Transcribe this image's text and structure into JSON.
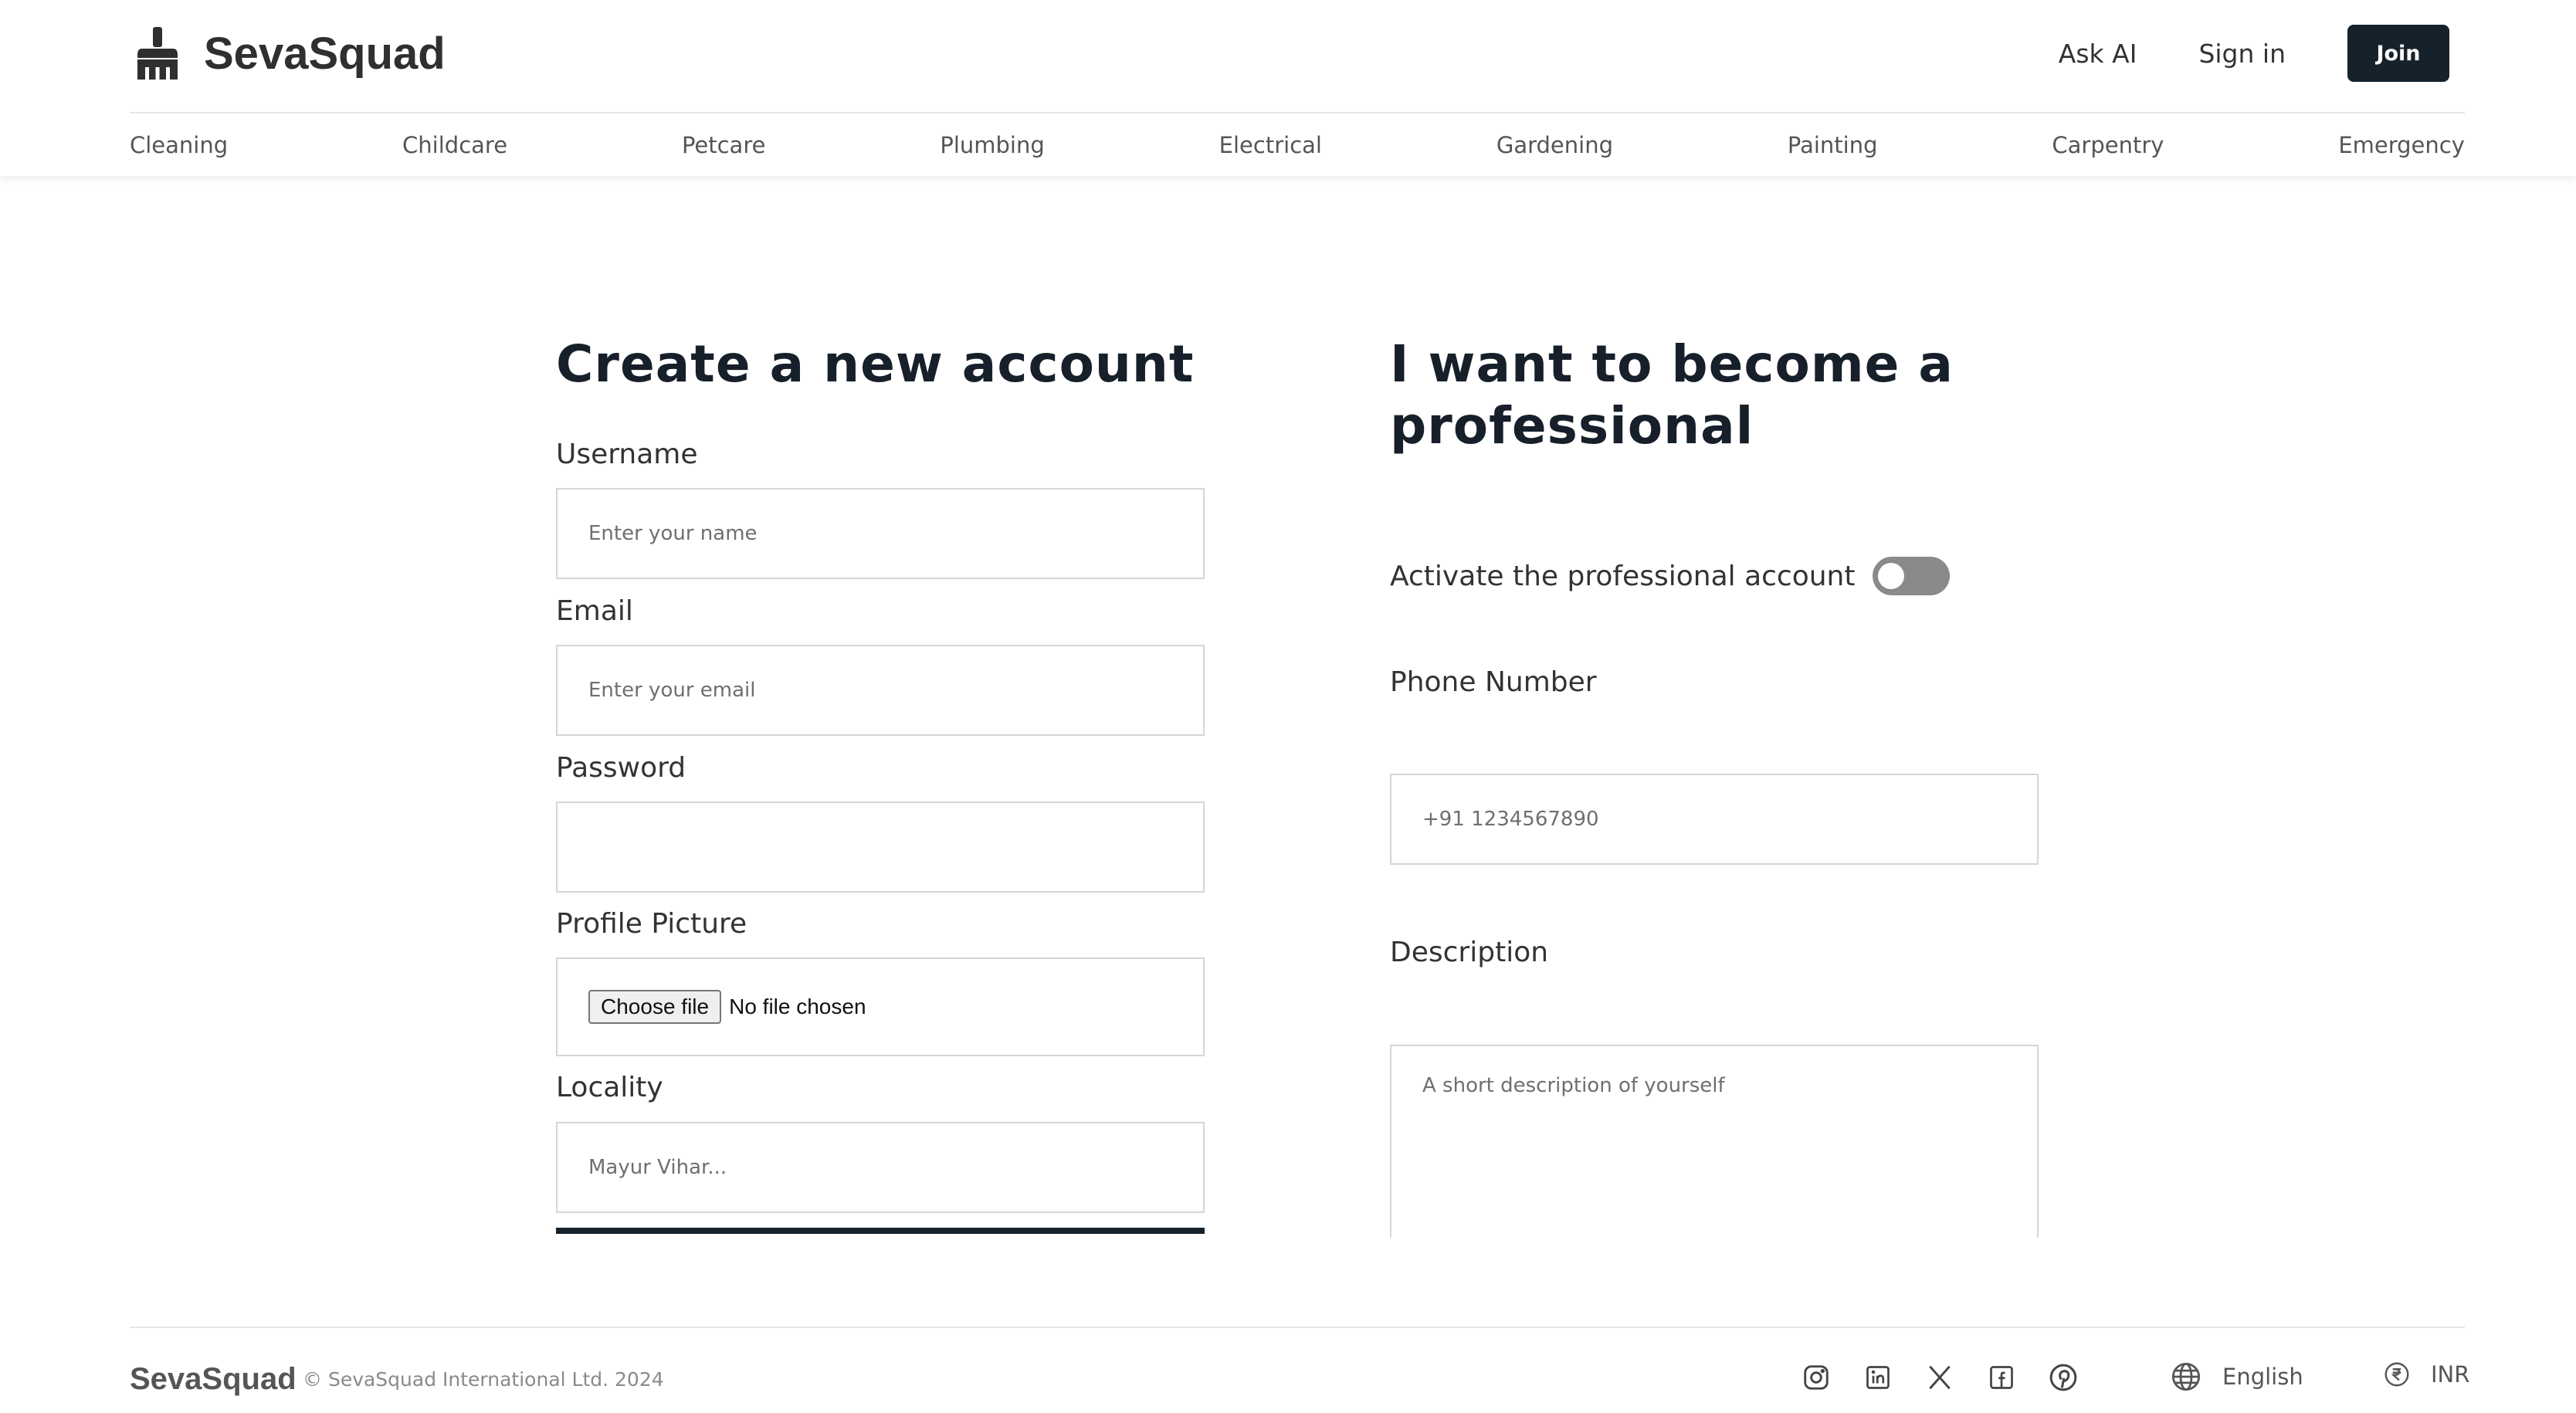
{
  "brand": {
    "name": "SevaSquad",
    "logo_icon": "broom-icon"
  },
  "header": {
    "ask_ai": "Ask AI",
    "sign_in": "Sign in",
    "join": "Join"
  },
  "categories": [
    "Cleaning",
    "Childcare",
    "Petcare",
    "Plumbing",
    "Electrical",
    "Gardening",
    "Painting",
    "Carpentry",
    "Emergency"
  ],
  "signup": {
    "title": "Create a new account",
    "username": {
      "label": "Username",
      "placeholder": "Enter your name",
      "value": ""
    },
    "email": {
      "label": "Email",
      "placeholder": "Enter your email",
      "value": ""
    },
    "password": {
      "label": "Password",
      "value": ""
    },
    "profile_picture": {
      "label": "Profile Picture",
      "button": "Choose file",
      "status": "No file chosen"
    },
    "locality": {
      "label": "Locality",
      "placeholder": "Mayur Vihar..."
    }
  },
  "professional": {
    "title_line1": "I want to become a",
    "title_line2": "professional",
    "activate_label": "Activate the professional account",
    "activate_on": false,
    "phone": {
      "label": "Phone Number",
      "placeholder": "+91 1234567890"
    },
    "description": {
      "label": "Description",
      "placeholder": "A short description of yourself"
    }
  },
  "footer": {
    "brand": "SevaSquad",
    "copyright": "© SevaSquad International Ltd. 2024",
    "social_icons": [
      "instagram-icon",
      "linkedin-icon",
      "x-icon",
      "facebook-icon",
      "pinterest-icon"
    ],
    "language": "English",
    "currency": "INR"
  },
  "colors": {
    "primary": "#16222b",
    "border": "#d3d6da",
    "toggle_off": "#8a8a8a"
  }
}
